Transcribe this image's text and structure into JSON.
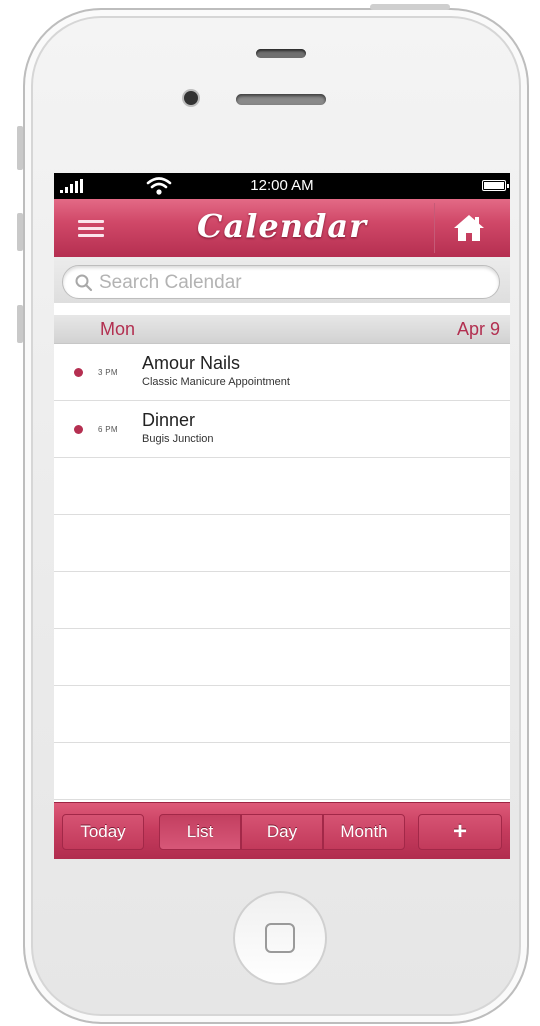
{
  "status_bar": {
    "time": "12:00 AM"
  },
  "nav": {
    "title": "Calendar",
    "menu_icon": "menu-icon",
    "home_icon": "home-icon"
  },
  "search": {
    "placeholder": "Search Calendar",
    "value": ""
  },
  "day_header": {
    "day": "Mon",
    "date": "Apr 9"
  },
  "events": [
    {
      "time": "3 PM",
      "title": "Amour Nails",
      "subtitle": "Classic Manicure Appointment"
    },
    {
      "time": "6 PM",
      "title": "Dinner",
      "subtitle": "Bugis Junction"
    }
  ],
  "toolbar": {
    "today": "Today",
    "list": "List",
    "day": "Day",
    "month": "Month",
    "add": "+"
  },
  "colors": {
    "accent": "#c73d5f",
    "dot": "#b52f51",
    "header_text": "#b22f50"
  }
}
